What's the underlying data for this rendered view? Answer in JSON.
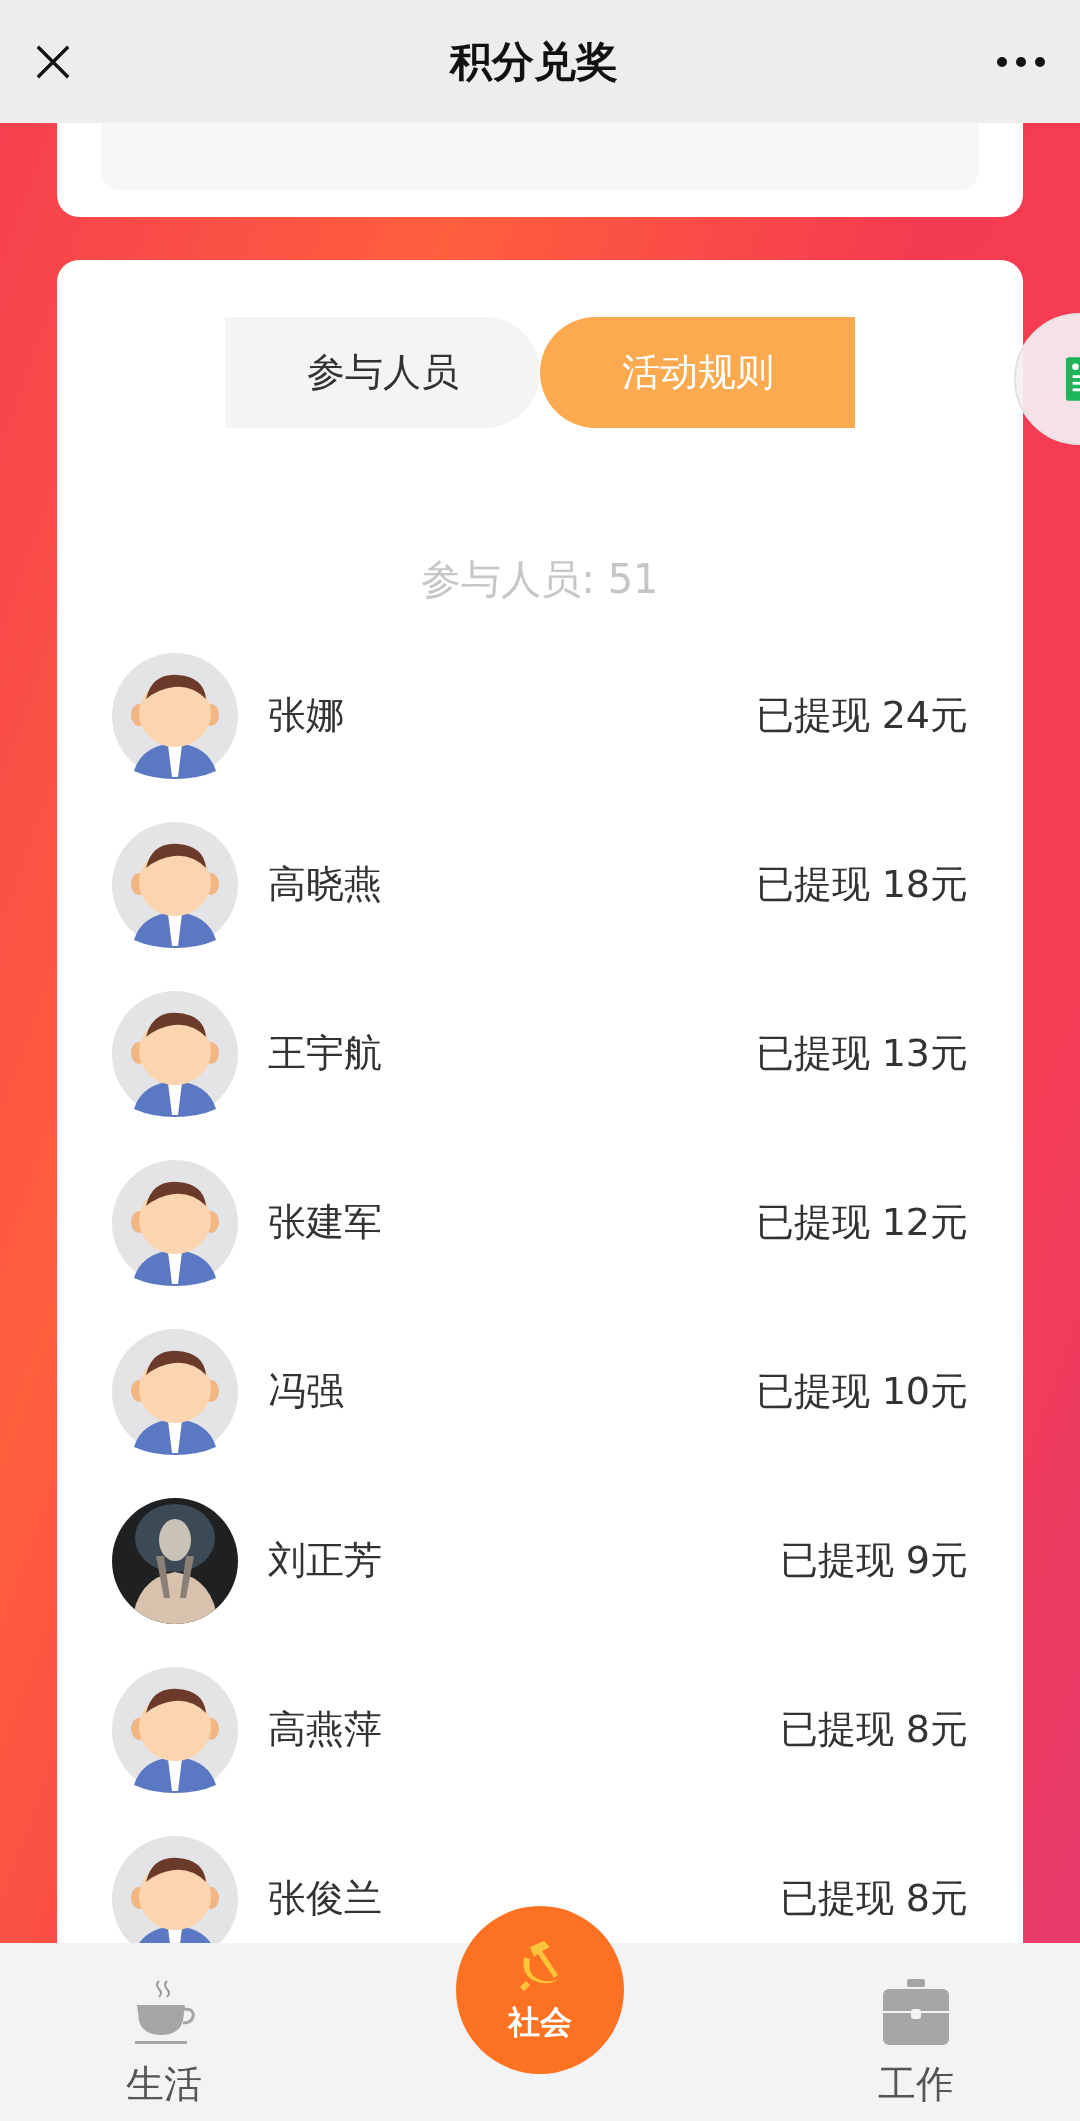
{
  "header": {
    "title": "积分兑奖"
  },
  "tabs": [
    {
      "label": "参与人员",
      "selected": false
    },
    {
      "label": "活动规则",
      "selected": true
    }
  ],
  "participants_count": "参与人员: 51",
  "rows": [
    {
      "name": "张娜",
      "amount": "已提现 24元",
      "kind": "cartoon"
    },
    {
      "name": "高晓燕",
      "amount": "已提现 18元",
      "kind": "cartoon"
    },
    {
      "name": "王宇航",
      "amount": "已提现 13元",
      "kind": "cartoon"
    },
    {
      "name": "张建军",
      "amount": "已提现 12元",
      "kind": "cartoon"
    },
    {
      "name": "冯强",
      "amount": "已提现 10元",
      "kind": "cartoon"
    },
    {
      "name": "刘正芳",
      "amount": "已提现 9元"
    },
    {
      "name": "高燕萍",
      "amount": "已提现 8元",
      "kind": "cartoon"
    },
    {
      "name": "张俊兰",
      "amount": "已提现 8元",
      "kind": "cartoon"
    }
  ],
  "bottom_nav": [
    {
      "label": "生活",
      "kind": "life"
    },
    {
      "label": "社会",
      "kind": "center"
    },
    {
      "label": "工作",
      "kind": "work"
    }
  ]
}
